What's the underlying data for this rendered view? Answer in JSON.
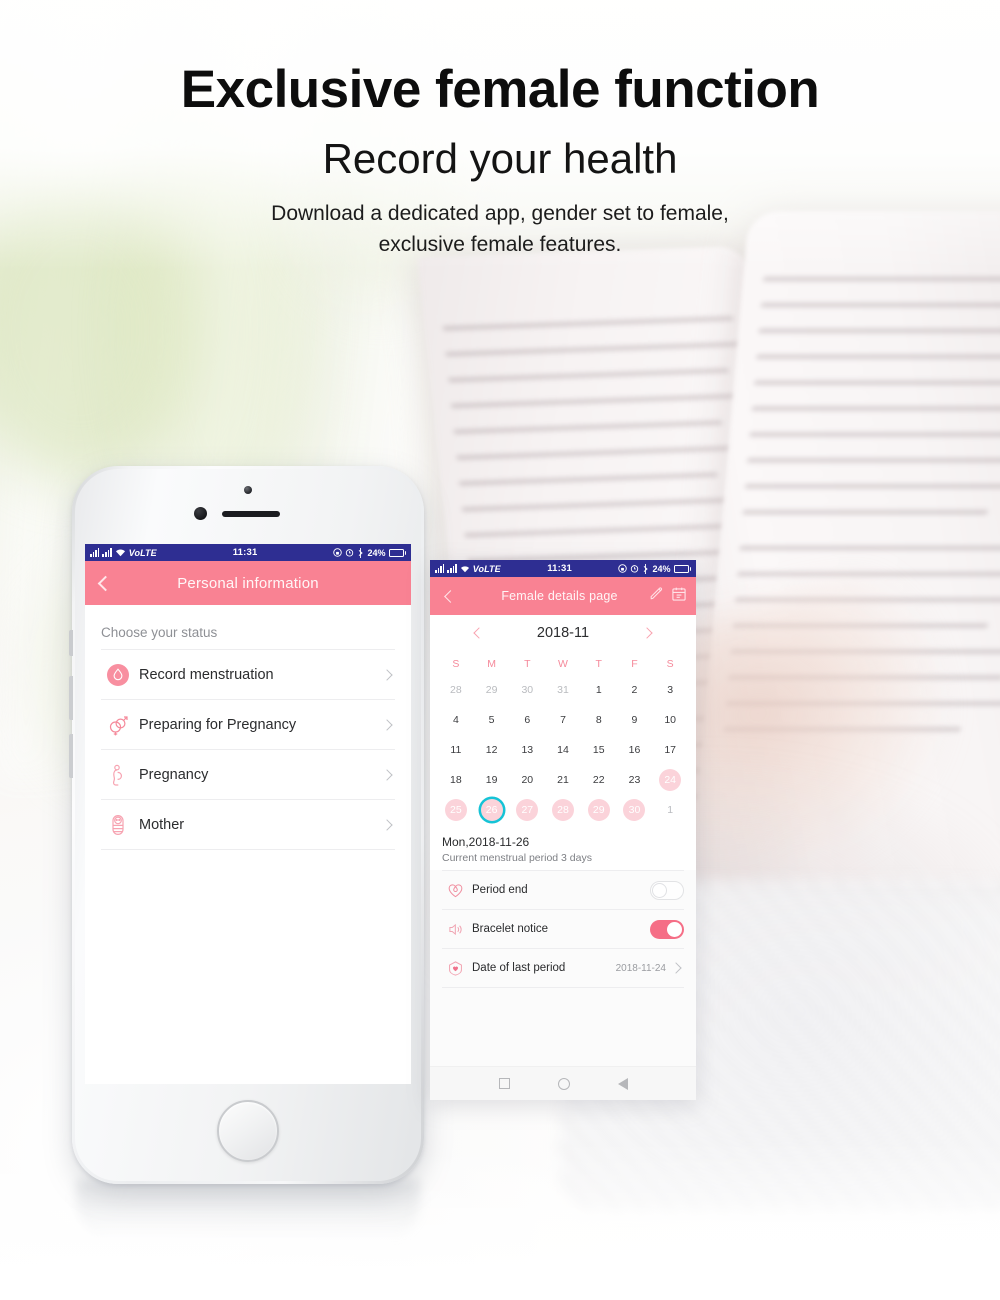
{
  "headline": {
    "title": "Exclusive female function",
    "subtitle": "Record your health",
    "description_line1": "Download a dedicated app, gender set to female,",
    "description_line2": "exclusive female features."
  },
  "colors": {
    "header_pink": "#f98293",
    "accent_pink": "#f56e86",
    "period_dot": "#fbd3da",
    "today_ring": "#15c3d6",
    "statusbar_blue": "#2e2e92"
  },
  "status_bar": {
    "carrier": "VoLTE",
    "time": "11:31",
    "battery_percent": "24%",
    "icons": [
      "signal-icon",
      "signal-icon",
      "wifi-icon",
      "rotation-lock-icon",
      "alarm-icon",
      "bluetooth-icon",
      "battery-icon"
    ]
  },
  "left_phone": {
    "appbar": {
      "back_icon": "chevron-left-icon",
      "title": "Personal information"
    },
    "section_label": "Choose your status",
    "items": [
      {
        "label": "Record menstruation",
        "icon": "droplet-filled-icon"
      },
      {
        "label": "Preparing for Pregnancy",
        "icon": "gender-symbols-icon"
      },
      {
        "label": "Pregnancy",
        "icon": "pregnant-woman-icon"
      },
      {
        "label": "Mother",
        "icon": "swaddled-baby-icon"
      }
    ]
  },
  "right_phone": {
    "appbar": {
      "back_icon": "chevron-left-icon",
      "title": "Female details page",
      "actions": [
        "pen-edit-icon",
        "calendar-icon"
      ]
    },
    "calendar": {
      "month_label": "2018-11",
      "prev_icon": "chevron-left-icon",
      "next_icon": "chevron-right-icon",
      "day_headers": [
        "S",
        "M",
        "T",
        "W",
        "T",
        "F",
        "S"
      ],
      "weeks": [
        [
          {
            "d": "28",
            "state": "mute"
          },
          {
            "d": "29",
            "state": "mute"
          },
          {
            "d": "30",
            "state": "mute"
          },
          {
            "d": "31",
            "state": "mute"
          },
          {
            "d": "1",
            "state": "normal"
          },
          {
            "d": "2",
            "state": "normal"
          },
          {
            "d": "3",
            "state": "normal"
          }
        ],
        [
          {
            "d": "4",
            "state": "normal"
          },
          {
            "d": "5",
            "state": "normal"
          },
          {
            "d": "6",
            "state": "normal"
          },
          {
            "d": "7",
            "state": "normal"
          },
          {
            "d": "8",
            "state": "normal"
          },
          {
            "d": "9",
            "state": "normal"
          },
          {
            "d": "10",
            "state": "normal"
          }
        ],
        [
          {
            "d": "11",
            "state": "normal"
          },
          {
            "d": "12",
            "state": "normal"
          },
          {
            "d": "13",
            "state": "normal"
          },
          {
            "d": "14",
            "state": "normal"
          },
          {
            "d": "15",
            "state": "normal"
          },
          {
            "d": "16",
            "state": "normal"
          },
          {
            "d": "17",
            "state": "normal"
          }
        ],
        [
          {
            "d": "18",
            "state": "normal"
          },
          {
            "d": "19",
            "state": "normal"
          },
          {
            "d": "20",
            "state": "normal"
          },
          {
            "d": "21",
            "state": "normal"
          },
          {
            "d": "22",
            "state": "normal"
          },
          {
            "d": "23",
            "state": "normal"
          },
          {
            "d": "24",
            "state": "period"
          }
        ],
        [
          {
            "d": "25",
            "state": "period"
          },
          {
            "d": "26",
            "state": "period-today"
          },
          {
            "d": "27",
            "state": "period"
          },
          {
            "d": "28",
            "state": "period"
          },
          {
            "d": "29",
            "state": "period"
          },
          {
            "d": "30",
            "state": "period"
          },
          {
            "d": "1",
            "state": "mute"
          }
        ]
      ]
    },
    "details": {
      "selected_date": "Mon,2018-11-26",
      "period_note": "Current menstrual period 3 days",
      "rows": [
        {
          "label": "Period end",
          "icon": "heart-droplet-icon",
          "control": "toggle",
          "toggle_state": "off"
        },
        {
          "label": "Bracelet notice",
          "icon": "speaker-icon",
          "control": "toggle",
          "toggle_state": "on"
        },
        {
          "label": "Date of last period",
          "icon": "shield-heart-icon",
          "control": "value",
          "value": "2018-11-24",
          "chevron": "chevron-right-icon"
        }
      ]
    },
    "nav_bar": {
      "icons": [
        "recent-apps-square-icon",
        "home-circle-icon",
        "back-triangle-icon"
      ]
    }
  }
}
